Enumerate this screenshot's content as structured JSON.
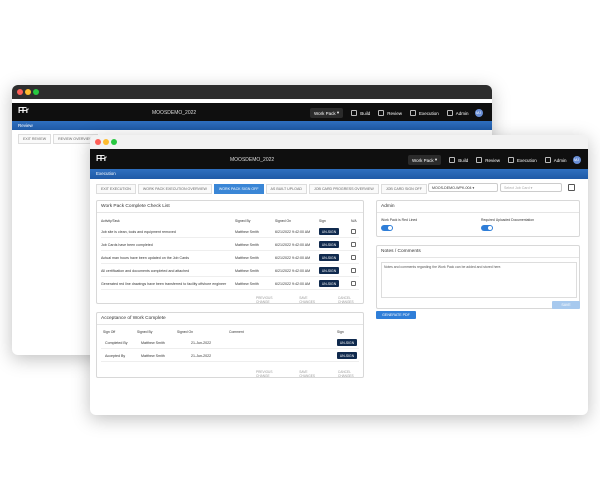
{
  "colors": {
    "accent": "#2f7ed8",
    "topbar": "#0f0f0f",
    "sign_button": "#102a4e"
  },
  "back_window": {
    "logo": "FFr",
    "project": "MOOSDEMO_2022",
    "nav": {
      "work_pack": "Work Pack",
      "build": "Build",
      "review": "Review",
      "execution": "Execution",
      "admin": "Admin",
      "avatar": "MJ"
    },
    "subbar_title": "Review",
    "tabs": [
      "EXIT REVIEW",
      "REVIEW OVERVIEW"
    ]
  },
  "front_window": {
    "logo": "FFr",
    "project": "MOOSDEMO_2022",
    "nav": {
      "work_pack": "Work Pack",
      "build": "Build",
      "review": "Review",
      "execution": "Execution",
      "admin": "Admin",
      "avatar": "MJ"
    },
    "subbar_title": "Execution",
    "tabs": [
      "EXIT EXECUTION",
      "WORK PACK EXECUTION OVERVIEW",
      "WORK PACK SIGN OFF",
      "AS BUILT UPLOAD",
      "JOB CARD PROGRESS OVERVIEW",
      "JOB CARD SIGN OFF"
    ],
    "active_tab": 2,
    "workpack_select": "MOOS-DEMO-WPK-004",
    "jobcard_placeholder": "Select Job Card",
    "checklist": {
      "title": "Work Pack Complete Check List",
      "headers": {
        "task": "Activity/Task",
        "signed_by": "Signed By",
        "signed_on": "Signed On",
        "sign": "Sign",
        "na": "N/A"
      },
      "rows": [
        {
          "task": "Job site is clean, tools and equipment removed",
          "by": "Matthew Smith",
          "on": "6/21/2022 9:42:00 AM",
          "btn": "UN-SIGN"
        },
        {
          "task": "Job Cards have been completed",
          "by": "Matthew Smith",
          "on": "6/21/2022 9:42:00 AM",
          "btn": "UN-SIGN"
        },
        {
          "task": "Actual man hours have been updated on the Job Cards",
          "by": "Matthew Smith",
          "on": "6/21/2022 9:42:00 AM",
          "btn": "UN-SIGN"
        },
        {
          "task": "All certification and documents completed and attached",
          "by": "Matthew Smith",
          "on": "6/21/2022 9:42:00 AM",
          "btn": "UN-SIGN"
        },
        {
          "task": "Generated red line drawings have been transferred to facility offshore engineer",
          "by": "Matthew Smith",
          "on": "6/21/2022 9:42:00 AM",
          "btn": "UN-SIGN"
        }
      ],
      "footer": [
        "PREVIOUS CHANGE",
        "SAVE CHANGES",
        "CANCEL CHANGES"
      ]
    },
    "acceptance": {
      "title": "Acceptance of Work Complete",
      "headers": {
        "sign_off": "Sign Off",
        "signed_by": "Signed By",
        "signed_on": "Signed On",
        "comment": "Comment",
        "sign": "Sign"
      },
      "rows": [
        {
          "label": "Completed By",
          "by": "Matthew Smith",
          "on": "21-Jun-2022",
          "btn": "UN-SIGN"
        },
        {
          "label": "Accepted By",
          "by": "Matthew Smith",
          "on": "21-Jun-2022",
          "btn": "UN-SIGN"
        }
      ],
      "footer": [
        "PREVIOUS CHANGE",
        "SAVE CHANGES",
        "CANCEL CHANGES"
      ]
    },
    "admin": {
      "title": "Admin",
      "toggle1_label": "Work Pack is Red Lined",
      "toggle2_label": "Required Uploaded Documentation"
    },
    "notes": {
      "title": "Notes / Comments",
      "text": "Notes and comments regarding the Work Pack can be added and stored here.",
      "save": "SAVE"
    },
    "generate_pdf": "GENERATE PDF"
  }
}
